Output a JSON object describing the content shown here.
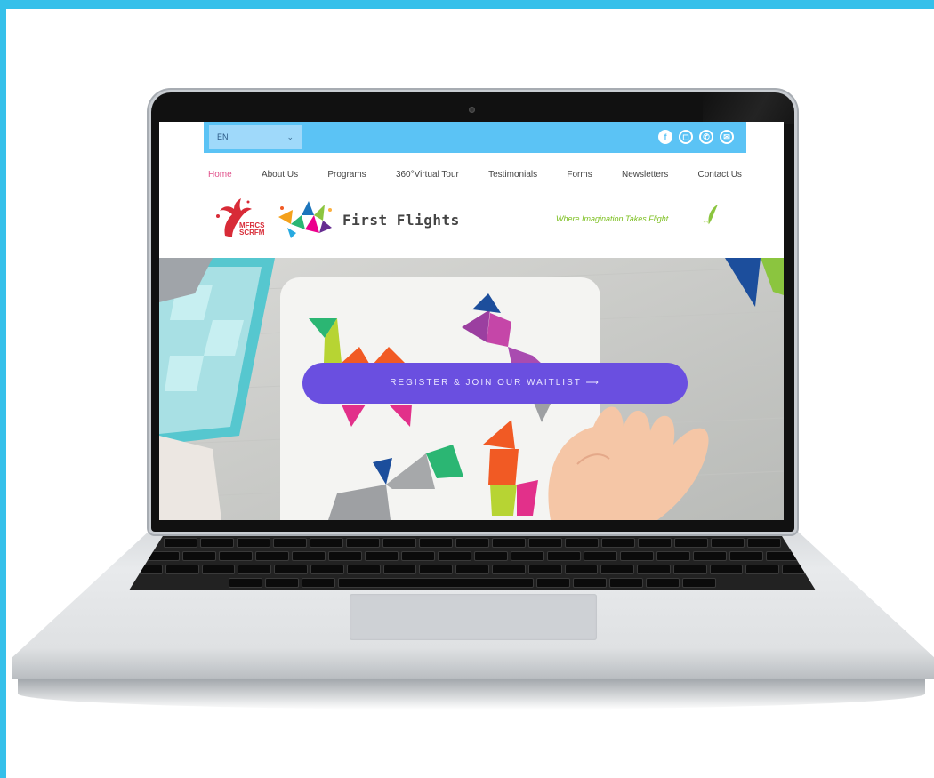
{
  "colors": {
    "frame": "#35c0ea",
    "topbar": "#5bc3f5",
    "nav_active": "#e0508a",
    "cta": "#6a4fe0",
    "tagline": "#7bbf1e"
  },
  "site": {
    "language": "EN",
    "social_icons": [
      "facebook-icon",
      "instagram-icon",
      "phone-icon",
      "email-icon"
    ],
    "nav": [
      "Home",
      "About Us",
      "Programs",
      "360°Virtual Tour",
      "Testimonials",
      "Forms",
      "Newsletters",
      "Contact Us"
    ],
    "active_nav": "Home",
    "partner_logo_text": [
      "MFRCS",
      "SCRFM"
    ],
    "brand_name": "First Flights",
    "tagline": "Where Imagination Takes Flight",
    "cta_label": "REGISTER & JOIN OUR WAITLIST ⟶"
  }
}
